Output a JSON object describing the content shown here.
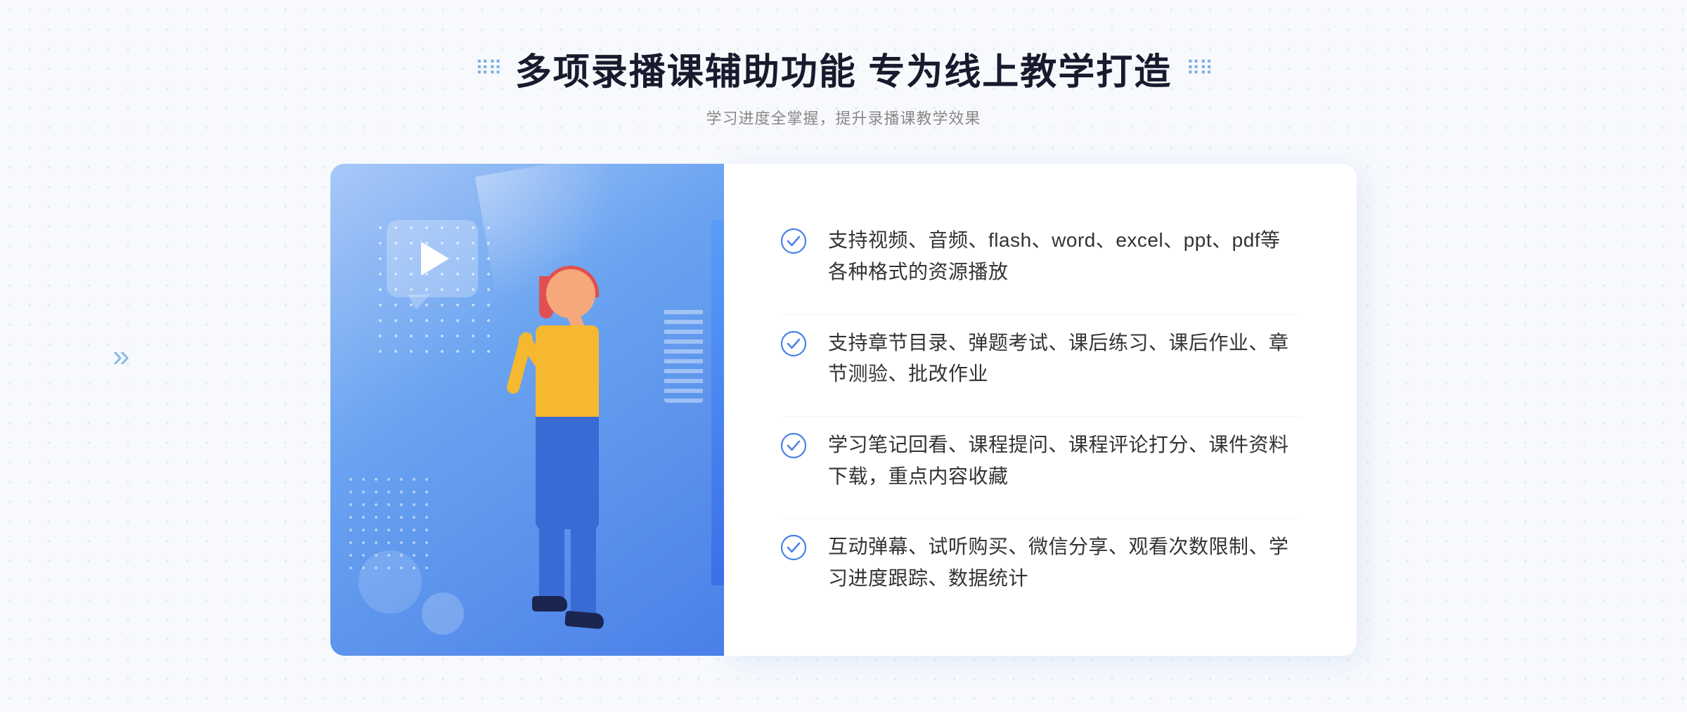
{
  "header": {
    "title_dots_left": "⠿⠿",
    "title_dots_right": "⠿⠿",
    "main_title": "多项录播课辅助功能 专为线上教学打造",
    "sub_title": "学习进度全掌握，提升录播课教学效果"
  },
  "features": [
    {
      "id": "feature-1",
      "text": "支持视频、音频、flash、word、excel、ppt、pdf等各种格式的资源播放"
    },
    {
      "id": "feature-2",
      "text": "支持章节目录、弹题考试、课后练习、课后作业、章节测验、批改作业"
    },
    {
      "id": "feature-3",
      "text": "学习笔记回看、课程提问、课程评论打分、课件资料下载，重点内容收藏"
    },
    {
      "id": "feature-4",
      "text": "互动弹幕、试听购买、微信分享、观看次数限制、学习进度跟踪、数据统计"
    }
  ],
  "colors": {
    "primary_blue": "#4a80e8",
    "check_color": "#4a80e8",
    "title_color": "#1a1a2e",
    "text_color": "#333333",
    "subtitle_color": "#888888"
  },
  "icons": {
    "check": "check-circle",
    "play": "play",
    "arrows_left": "»"
  }
}
